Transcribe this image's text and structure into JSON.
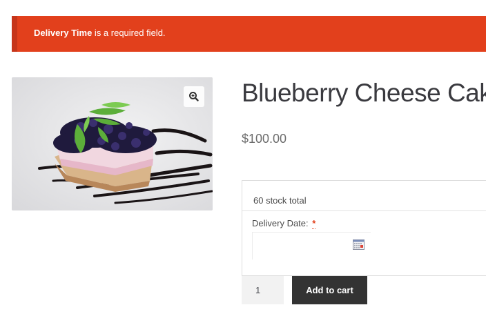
{
  "notice": {
    "field_name": "Delivery Time",
    "message_rest": " is a required field."
  },
  "product": {
    "title": "Blueberry Cheese Cake",
    "price": "$100.00",
    "image_alt": "Blueberry cheesecake slice with mint leaves"
  },
  "booking": {
    "stock_text": "60 stock total",
    "date_label": "Delivery Date:",
    "required_mark": "*"
  },
  "cart": {
    "quantity": "1",
    "add_label": "Add to cart"
  },
  "colors": {
    "notice_bg": "#e2401c",
    "button_bg": "#333333"
  },
  "icons": [
    "zoom-icon",
    "calendar-icon"
  ]
}
